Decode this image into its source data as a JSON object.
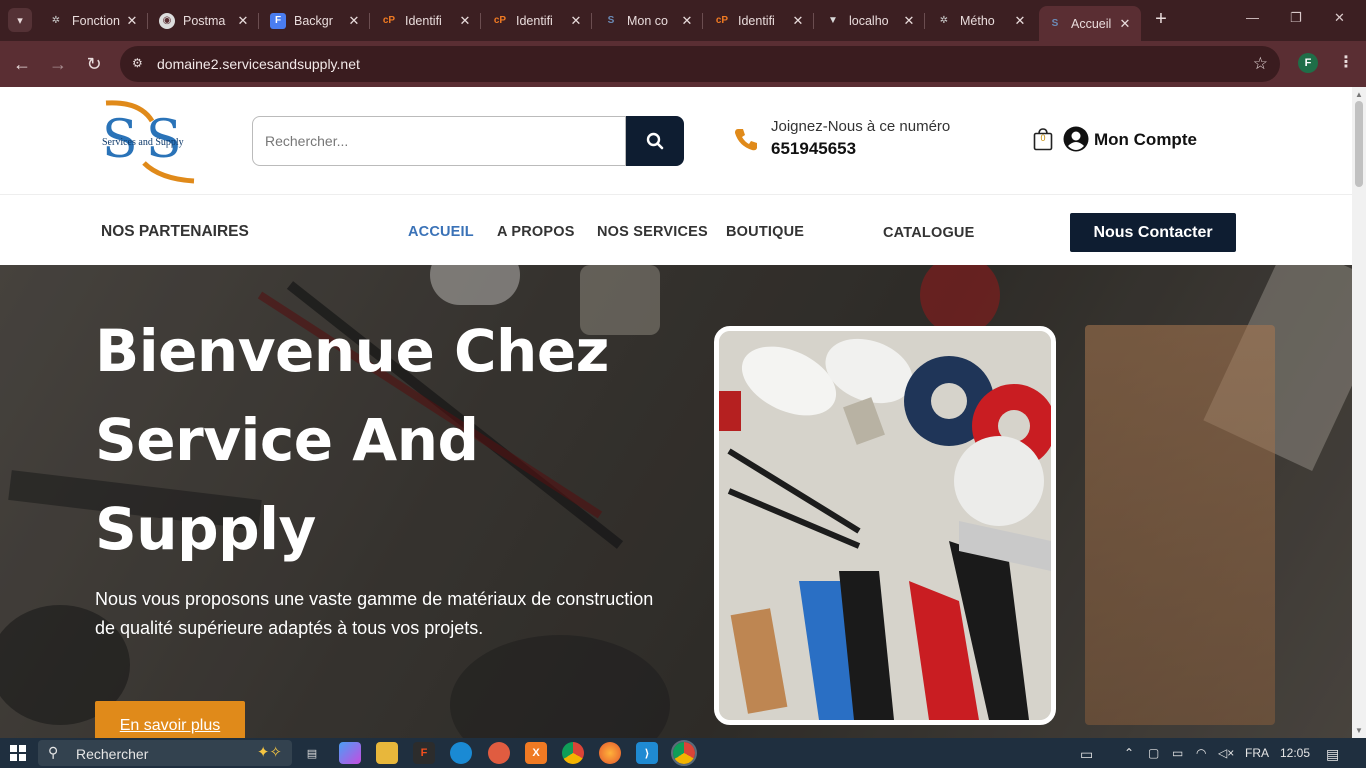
{
  "browser": {
    "tabs": [
      {
        "title": "Fonction",
        "favicon": "openai-icon",
        "color": "#cfcfcf"
      },
      {
        "title": "Postma",
        "favicon": "postman-icon",
        "color": "#cfcfcf"
      },
      {
        "title": "Backgr",
        "favicon": "docs-icon",
        "color": "#4a7df0"
      },
      {
        "title": "Identifi",
        "favicon": "cpanel-icon",
        "color": "#f07a23"
      },
      {
        "title": "Identifi",
        "favicon": "cpanel-icon",
        "color": "#f07a23"
      },
      {
        "title": "Mon co",
        "favicon": "ss-icon",
        "color": "#6b8bb7"
      },
      {
        "title": "Identifi",
        "favicon": "cpanel-icon",
        "color": "#f07a23"
      },
      {
        "title": "localho",
        "favicon": "vue-icon",
        "color": "#d9d9d9"
      },
      {
        "title": "Métho",
        "favicon": "openai-icon",
        "color": "#cfcfcf"
      },
      {
        "title": "Accueil",
        "favicon": "ss-icon",
        "color": "#6b8bb7"
      }
    ],
    "url": "domaine2.servicesandsupply.net",
    "profile_initial": "F"
  },
  "site": {
    "logo_text": "Services and Supply",
    "search_placeholder": "Rechercher...",
    "phone_label": "Joignez-Nous à ce numéro",
    "phone_number": "651945653",
    "cart_count": "0",
    "account_label": "Mon Compte",
    "partners_label": "NOS PARTENAIRES",
    "nav": [
      {
        "label": "ACCUEIL",
        "active": true
      },
      {
        "label": "A PROPOS",
        "active": false
      },
      {
        "label": "NOS SERVICES",
        "active": false
      },
      {
        "label": "BOUTIQUE",
        "active": false
      },
      {
        "label": "CATALOGUE",
        "active": false
      }
    ],
    "contact_label": "Nous Contacter",
    "hero": {
      "title": "Bienvenue Chez Service And Supply",
      "subtitle": "Nous vous proposons une vaste gamme de matériaux de construction de qualité supérieure adaptés à tous vos projets.",
      "button": "En savoir plus"
    },
    "colors": {
      "navy": "#0e1d31",
      "accent_orange": "#e08a1a",
      "link_blue": "#3a72b7"
    }
  },
  "taskbar": {
    "search_placeholder": "Rechercher",
    "language": "FRA",
    "time": "12:05"
  }
}
